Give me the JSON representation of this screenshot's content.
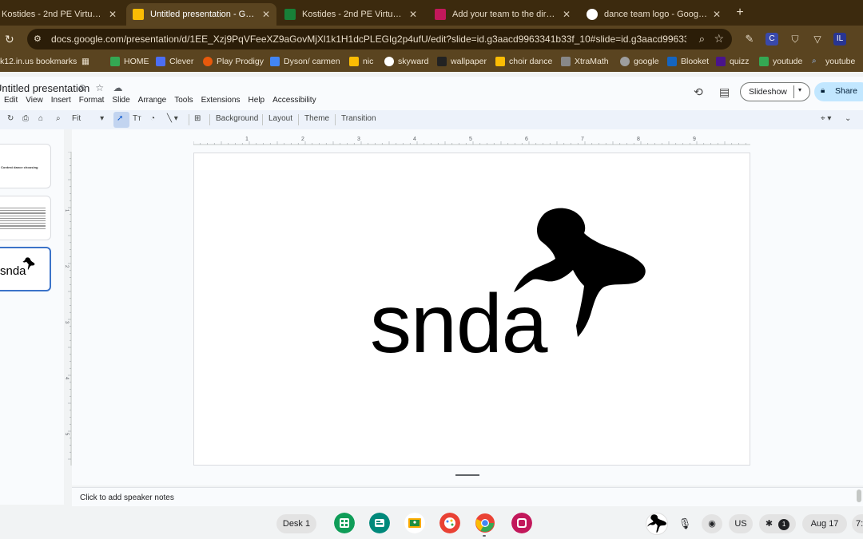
{
  "browser": {
    "tabs": [
      {
        "title": "Kostides - 2nd PE Virtual Mond",
        "favicon_color": "#34a853",
        "active": false
      },
      {
        "title": "Untitled presentation - Google ...",
        "favicon_color": "#fbbc04",
        "active": true
      },
      {
        "title": "Kostides - 2nd PE Virtual Mond",
        "favicon_color": "#188038",
        "active": false
      },
      {
        "title": "Add your team to the directory",
        "favicon_color": "#c2185b",
        "active": false
      },
      {
        "title": "dance team logo - Google Sear",
        "favicon_color": "#4285f4",
        "active": false
      }
    ],
    "url": "docs.google.com/presentation/d/1EE_Xzj9PqVFeeXZ9aGovMjXl1k1H1dcPLEGIg2p4ufU/edit?slide=id.g3aacd9963341b33f_10#slide=id.g3aacd9963341b33f_...",
    "extensions": [
      "C",
      "IL"
    ],
    "bookmarks": [
      {
        "label": "k12.in.us bookmarks",
        "color": ""
      },
      {
        "label": "HOME",
        "color": "#34a853"
      },
      {
        "label": "Clever",
        "color": "#4c6ef5"
      },
      {
        "label": "Play Prodigy",
        "color": "#e8590c"
      },
      {
        "label": "Dyson/ carmen",
        "color": "#4285f4"
      },
      {
        "label": "nic",
        "color": "#fbbc04"
      },
      {
        "label": "skyward",
        "color": "#ffffff"
      },
      {
        "label": "wallpaper",
        "color": "#222222"
      },
      {
        "label": "choir dance",
        "color": "#fbbc04"
      },
      {
        "label": "XtraMath",
        "color": "#888888"
      },
      {
        "label": "google",
        "color": "#9e9e9e"
      },
      {
        "label": "Blooket",
        "color": "#1565c0"
      },
      {
        "label": "quizz",
        "color": "#4a148c"
      },
      {
        "label": "youtude",
        "color": "#34a853"
      },
      {
        "label": "youtube",
        "color": "#4285f4"
      }
    ]
  },
  "docs": {
    "title": "Untitled presentation",
    "menu": [
      "Edit",
      "View",
      "Insert",
      "Format",
      "Slide",
      "Arrange",
      "Tools",
      "Extensions",
      "Help",
      "Accessibility"
    ],
    "slideshow_label": "Slideshow",
    "share_label": "Share",
    "toolbar": {
      "zoom": "Fit",
      "background": "Background",
      "layout": "Layout",
      "theme": "Theme",
      "transition": "Transition"
    },
    "thumbnails": [
      {
        "text": "Contest dance choosing"
      },
      {
        "text": ""
      },
      {
        "text": "snda"
      }
    ],
    "ruler_numbers": [
      "1",
      "2",
      "3",
      "4",
      "5",
      "6",
      "7",
      "8",
      "9"
    ],
    "left_ruler_numbers": [
      "1",
      "2",
      "3",
      "4",
      "5"
    ],
    "slide": {
      "brand_text": "snda"
    },
    "speaker_notes_placeholder": "Click to add speaker notes"
  },
  "shelf": {
    "desk_label": "Desk 1",
    "apps": [
      {
        "name": "sheets",
        "color": "#0f9d58"
      },
      {
        "name": "classroom-meet",
        "color": "#00897b"
      },
      {
        "name": "classroom",
        "color": "#f9ab00"
      },
      {
        "name": "canvas",
        "color": "#e94235"
      },
      {
        "name": "chrome",
        "color": "#4285f4"
      },
      {
        "name": "app",
        "color": "#c2185b"
      }
    ],
    "keyboard_layout": "US",
    "notification_count": "1",
    "date": "Aug 17",
    "time_partial": "7:"
  }
}
